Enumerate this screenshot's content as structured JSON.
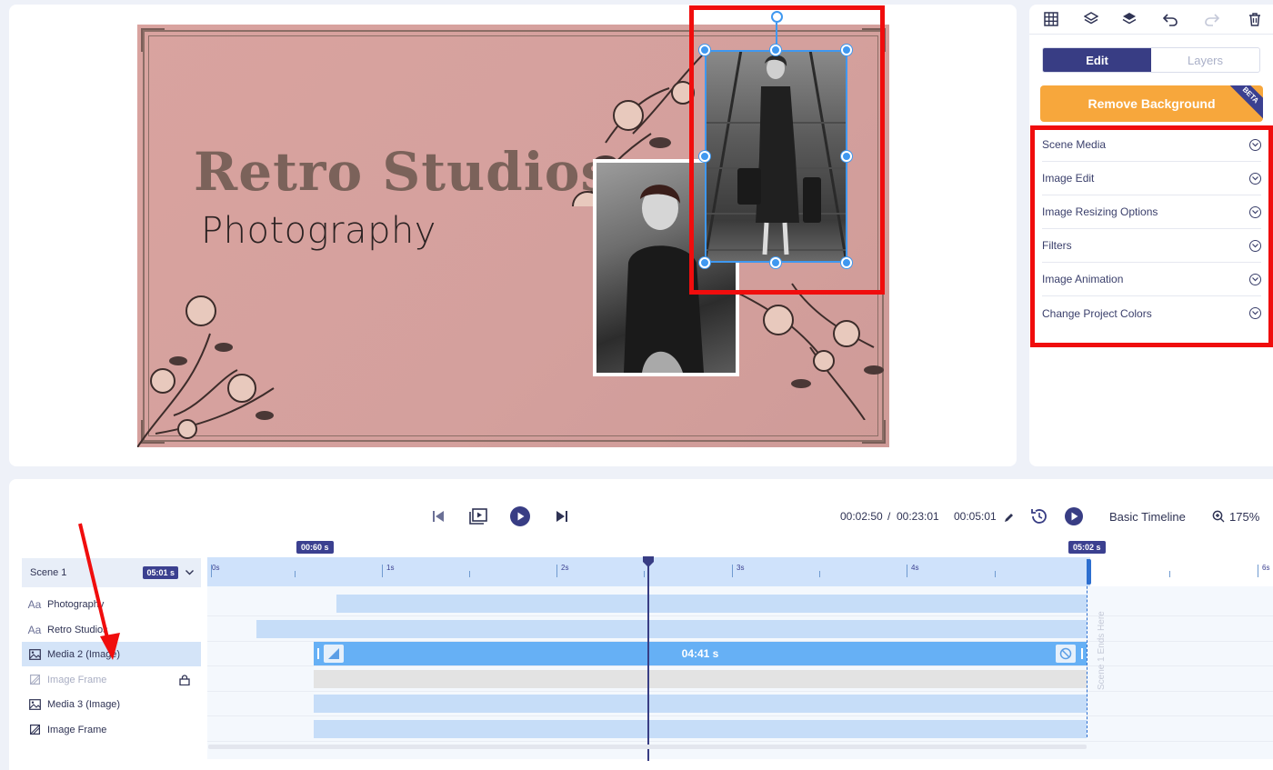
{
  "canvas": {
    "title": "Retro Studios",
    "subtitle": "Photography"
  },
  "right_panel": {
    "tabs": [
      {
        "label": "Edit",
        "active": true
      },
      {
        "label": "Layers",
        "active": false
      }
    ],
    "remove_background": "Remove Background",
    "beta_badge": "BETA",
    "accordion": [
      "Scene Media",
      "Image Edit",
      "Image Resizing Options",
      "Filters",
      "Image Animation",
      "Change Project Colors"
    ],
    "toolbar_icons": [
      "grid-icon",
      "layers-down-icon",
      "layers-up-icon",
      "undo-icon",
      "redo-icon",
      "trash-icon"
    ]
  },
  "timeline": {
    "current_time": "00:02:50",
    "separator": "/",
    "total_time": "00:23:01",
    "scene_duration": "00:05:01",
    "mode": "Basic Timeline",
    "zoom": "175%",
    "scene_name": "Scene 1",
    "scene_badge": "05:01 s",
    "start_badge": "00:60 s",
    "end_badge": "05:02 s",
    "ruler_labels": [
      "0s",
      "1s",
      "2s",
      "3s",
      "4s",
      "6s"
    ],
    "selected_bar_label": "04:41 s",
    "scene_end_text": "Scene 1 Ends Here",
    "layers": [
      {
        "icon": "Aa",
        "label": "Photography"
      },
      {
        "icon": "Aa",
        "label": "Retro Studios"
      },
      {
        "icon": "image",
        "label": "Media 2 (Image)"
      },
      {
        "icon": "frame",
        "label": "Image Frame"
      },
      {
        "icon": "image",
        "label": "Media 3 (Image)"
      },
      {
        "icon": "frame",
        "label": "Image Frame"
      }
    ]
  },
  "colors": {
    "accent": "#383d84",
    "orange": "#f7a73c",
    "highlight": "#f00d0d",
    "selection": "#3f98f0"
  }
}
